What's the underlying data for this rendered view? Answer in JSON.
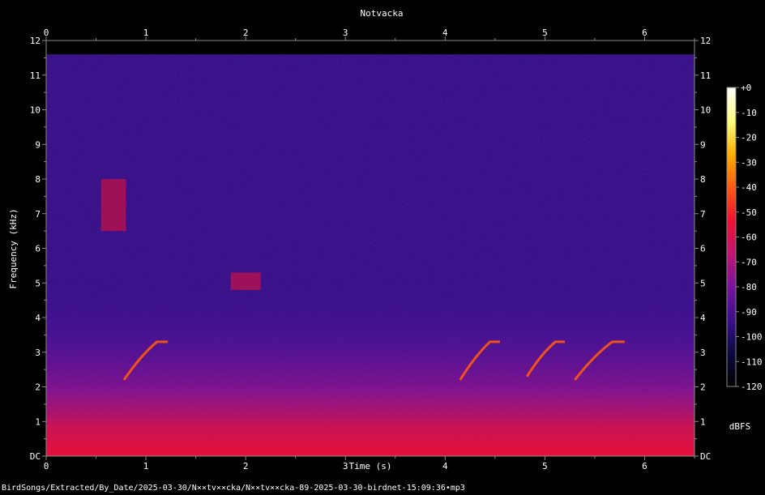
{
  "chart_data": {
    "type": "heatmap",
    "title": "Notvacka",
    "xlabel": "Time (s)",
    "ylabel": "Frequency (kHz)",
    "xlim": [
      0,
      6.5
    ],
    "ylim": [
      0,
      12
    ],
    "x_ticks": [
      {
        "value": 0,
        "label": "0"
      },
      {
        "value": 1,
        "label": "1"
      },
      {
        "value": 2,
        "label": "2"
      },
      {
        "value": 3,
        "label": "3"
      },
      {
        "value": 4,
        "label": "4"
      },
      {
        "value": 5,
        "label": "5"
      },
      {
        "value": 6,
        "label": "6"
      }
    ],
    "y_ticks": [
      {
        "value": 0,
        "label": "DC"
      },
      {
        "value": 1,
        "label": "1"
      },
      {
        "value": 2,
        "label": "2"
      },
      {
        "value": 3,
        "label": "3"
      },
      {
        "value": 4,
        "label": "4"
      },
      {
        "value": 5,
        "label": "5"
      },
      {
        "value": 6,
        "label": "6"
      },
      {
        "value": 7,
        "label": "7"
      },
      {
        "value": 8,
        "label": "8"
      },
      {
        "value": 9,
        "label": "9"
      },
      {
        "value": 10,
        "label": "10"
      },
      {
        "value": 11,
        "label": "11"
      },
      {
        "value": 12,
        "label": "12"
      }
    ],
    "colorbar": {
      "label": "dBFS",
      "range": [
        -120,
        0
      ],
      "ticks": [
        {
          "value": 0,
          "label": "+0"
        },
        {
          "value": -10,
          "label": "-10"
        },
        {
          "value": -20,
          "label": "-20"
        },
        {
          "value": -30,
          "label": "-30"
        },
        {
          "value": -40,
          "label": "-40"
        },
        {
          "value": -50,
          "label": "-50"
        },
        {
          "value": -60,
          "label": "-60"
        },
        {
          "value": -70,
          "label": "-70"
        },
        {
          "value": -80,
          "label": "-80"
        },
        {
          "value": -90,
          "label": "-90"
        },
        {
          "value": -100,
          "label": "-100"
        },
        {
          "value": -110,
          "label": "-110"
        },
        {
          "value": -120,
          "label": "-120"
        }
      ],
      "colors": [
        "#000000",
        "#0a0a40",
        "#3a0e8c",
        "#7a12a0",
        "#c41470",
        "#f01030",
        "#ff5a10",
        "#ffb000",
        "#ffff80",
        "#ffffff"
      ]
    },
    "background_level_db": -95,
    "calls": [
      {
        "t_start": 0.78,
        "t_end": 1.22,
        "f_start_khz": 2.2,
        "f_end_khz": 3.3,
        "level_db": -45
      },
      {
        "t_start": 4.15,
        "t_end": 4.55,
        "f_start_khz": 2.2,
        "f_end_khz": 3.3,
        "level_db": -40
      },
      {
        "t_start": 4.82,
        "t_end": 5.2,
        "f_start_khz": 2.3,
        "f_end_khz": 3.3,
        "level_db": -40
      },
      {
        "t_start": 5.3,
        "t_end": 5.8,
        "f_start_khz": 2.2,
        "f_end_khz": 3.3,
        "level_db": -42
      }
    ],
    "patches": [
      {
        "t_start": 0.55,
        "t_end": 0.8,
        "f_low_khz": 6.5,
        "f_high_khz": 8.0,
        "level_db": -55
      },
      {
        "t_start": 1.85,
        "t_end": 2.15,
        "f_low_khz": 4.8,
        "f_high_khz": 5.3,
        "level_db": -55
      }
    ]
  },
  "footer": {
    "caption": "BirdSongs/Extracted/By_Date/2025-03-30/N××tv××cka/N××tv××cka-89-2025-03-30-birdnet-15:09:36•mp3"
  }
}
